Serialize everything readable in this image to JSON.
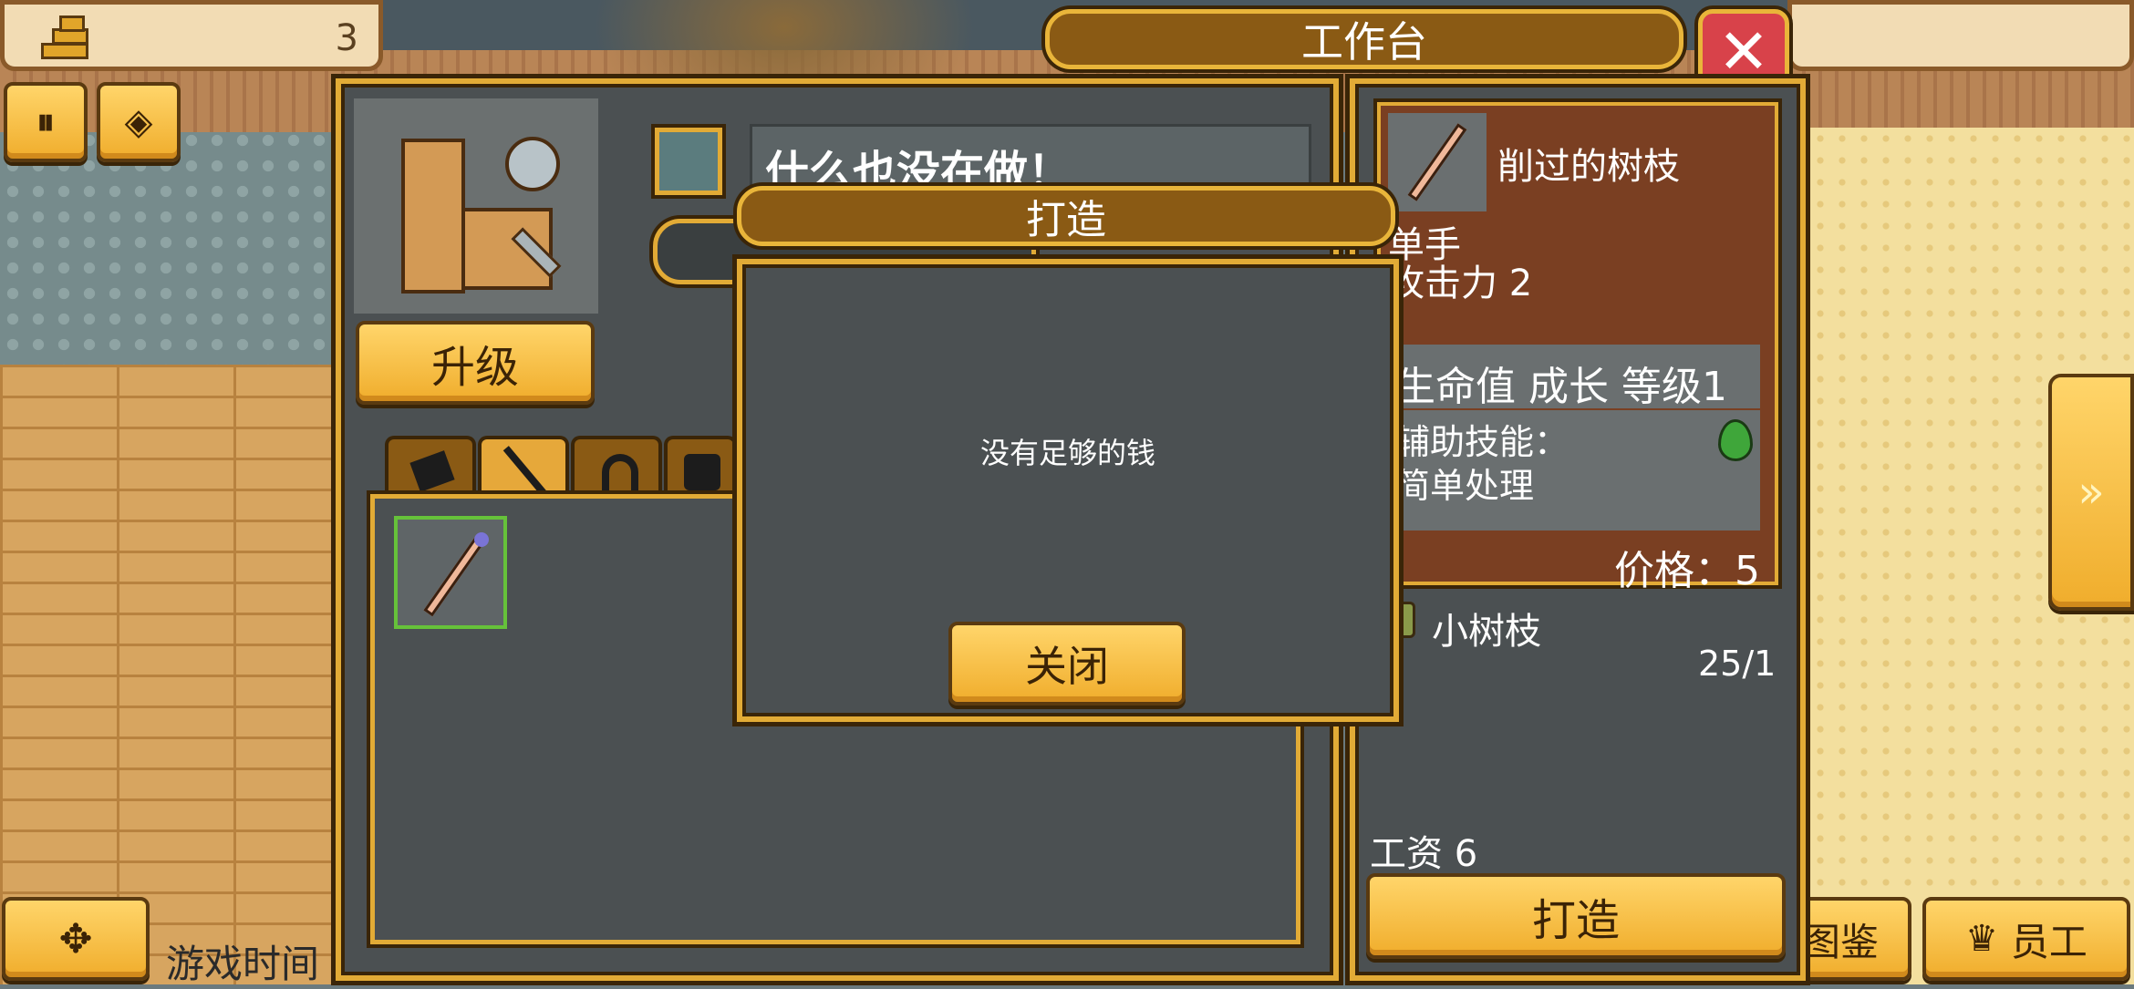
{
  "hud": {
    "coin_count": "3",
    "game_time_label": "游戏时间"
  },
  "workbench": {
    "title": "工作台",
    "status_text": "什么也没在做！",
    "upgrade_label": "升级",
    "category_tabs": [
      "weapon-tab-block",
      "weapon-tab-stick",
      "helmet-tab",
      "armor-tab"
    ]
  },
  "item_detail": {
    "name": "削过的树枝",
    "hand_type": "单手",
    "attack_line": "攻击力 2",
    "stats_line": "生命值 成长 等级1",
    "support_skill_label": "辅助技能：",
    "support_skill_value": "简单处理",
    "price": "价格：5",
    "material_name": "小树枝",
    "material_count": "25/1",
    "wage": "工资 6",
    "craft_button": "打造"
  },
  "dialog": {
    "title": "打造",
    "message": "没有足够的钱",
    "close_label": "关闭"
  },
  "bottom_bar": {
    "codex_label": "图鉴",
    "staff_label": "员工"
  },
  "colors": {
    "gold": "#e2ab36",
    "panel_dark": "#4b5052",
    "title_brown": "#8a5a14",
    "close_red": "#d8424a",
    "detail_brown": "#7a3f22"
  }
}
